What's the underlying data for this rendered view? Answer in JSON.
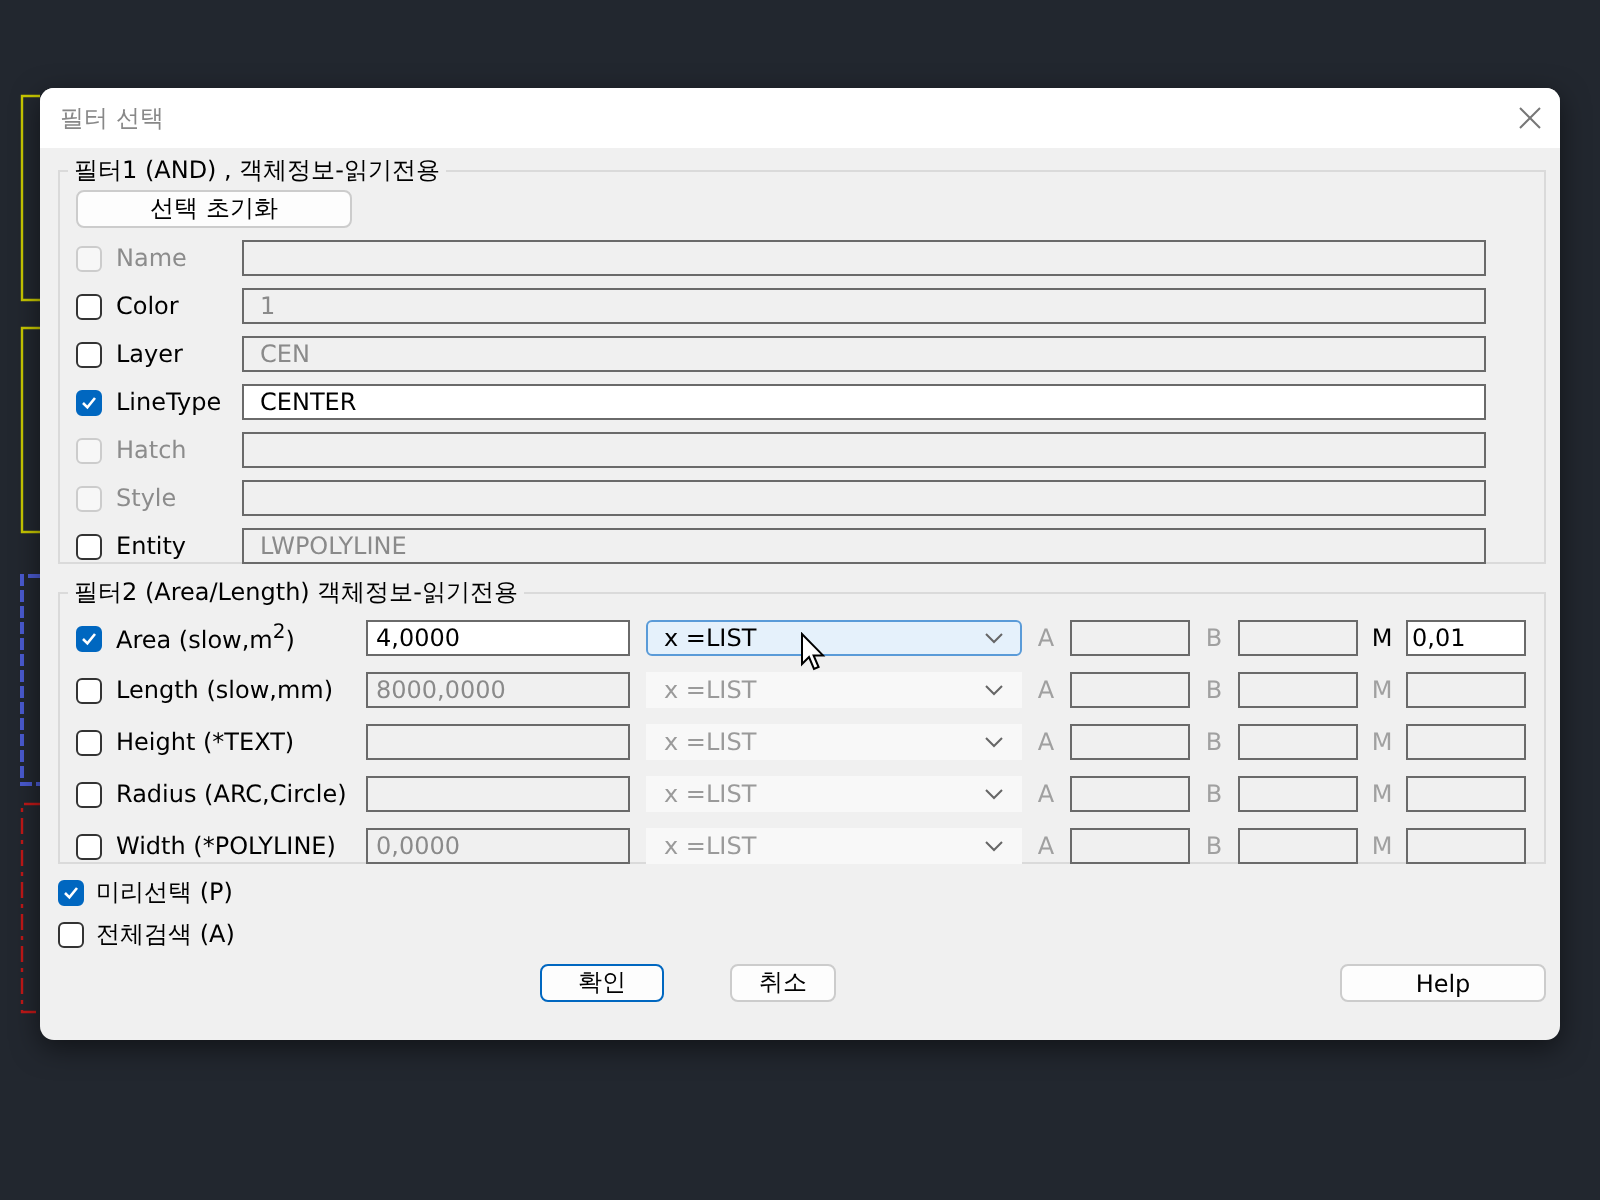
{
  "window": {
    "title": "필터 선택"
  },
  "filter1": {
    "legend": "필터1 (AND) , 객체정보-읽기전용",
    "reset_button": "선택 초기화",
    "rows": [
      {
        "label": "Name",
        "enabled": false,
        "checked": false
      },
      {
        "label": "Color",
        "enabled": true,
        "checked": false,
        "value": "1"
      },
      {
        "label": "Layer",
        "enabled": true,
        "checked": false,
        "value": "CEN"
      },
      {
        "label": "LineType",
        "enabled": true,
        "checked": true,
        "value": "CENTER"
      },
      {
        "label": "Hatch",
        "enabled": false,
        "checked": false
      },
      {
        "label": "Style",
        "enabled": false,
        "checked": false
      },
      {
        "label": "Entity",
        "enabled": true,
        "checked": false,
        "value": "LWPOLYLINE"
      }
    ]
  },
  "filter2": {
    "legend": "필터2 (Area/Length) 객체정보-읽기전용",
    "rows": [
      {
        "label": "Area (slow,m$^{2}$)",
        "checked": true,
        "value": "4,0000",
        "combo": "x =LIST",
        "combo_enabled": true,
        "combo_hovered": true,
        "params": [
          {
            "label": "A",
            "enabled": false
          },
          {
            "label": "B",
            "enabled": false
          },
          {
            "label": "M",
            "enabled": true,
            "value": "0,01"
          }
        ]
      },
      {
        "label": "Length (slow,mm)",
        "checked": false,
        "value": "8000,0000",
        "combo": "x =LIST",
        "combo_enabled": false,
        "combo_hovered": false,
        "params": [
          {
            "label": "A",
            "enabled": false
          },
          {
            "label": "B",
            "enabled": false
          },
          {
            "label": "M",
            "enabled": false
          }
        ]
      },
      {
        "label": "Height (*TEXT)",
        "checked": false,
        "combo": "x =LIST",
        "combo_enabled": false,
        "combo_hovered": false,
        "params": [
          {
            "label": "A",
            "enabled": false
          },
          {
            "label": "B",
            "enabled": false
          },
          {
            "label": "M",
            "enabled": false
          }
        ]
      },
      {
        "label": "Radius (ARC,Circle)",
        "checked": false,
        "combo": "x =LIST",
        "combo_enabled": false,
        "combo_hovered": false,
        "params": [
          {
            "label": "A",
            "enabled": false
          },
          {
            "label": "B",
            "enabled": false
          },
          {
            "label": "M",
            "enabled": false
          }
        ]
      },
      {
        "label": "Width (*POLYLINE)",
        "checked": false,
        "value": "0,0000",
        "combo": "x =LIST",
        "combo_enabled": false,
        "combo_hovered": false,
        "params": [
          {
            "label": "A",
            "enabled": false
          },
          {
            "label": "B",
            "enabled": false
          },
          {
            "label": "M",
            "enabled": false
          }
        ]
      }
    ]
  },
  "options": [
    {
      "label": "미리선택 (P)",
      "checked": true
    },
    {
      "label": "전체검색 (A)",
      "checked": false
    }
  ],
  "buttons": [
    {
      "label": "확인",
      "default": true
    },
    {
      "label": "취소",
      "default": false
    },
    {
      "label": "Help",
      "default": false
    }
  ]
}
